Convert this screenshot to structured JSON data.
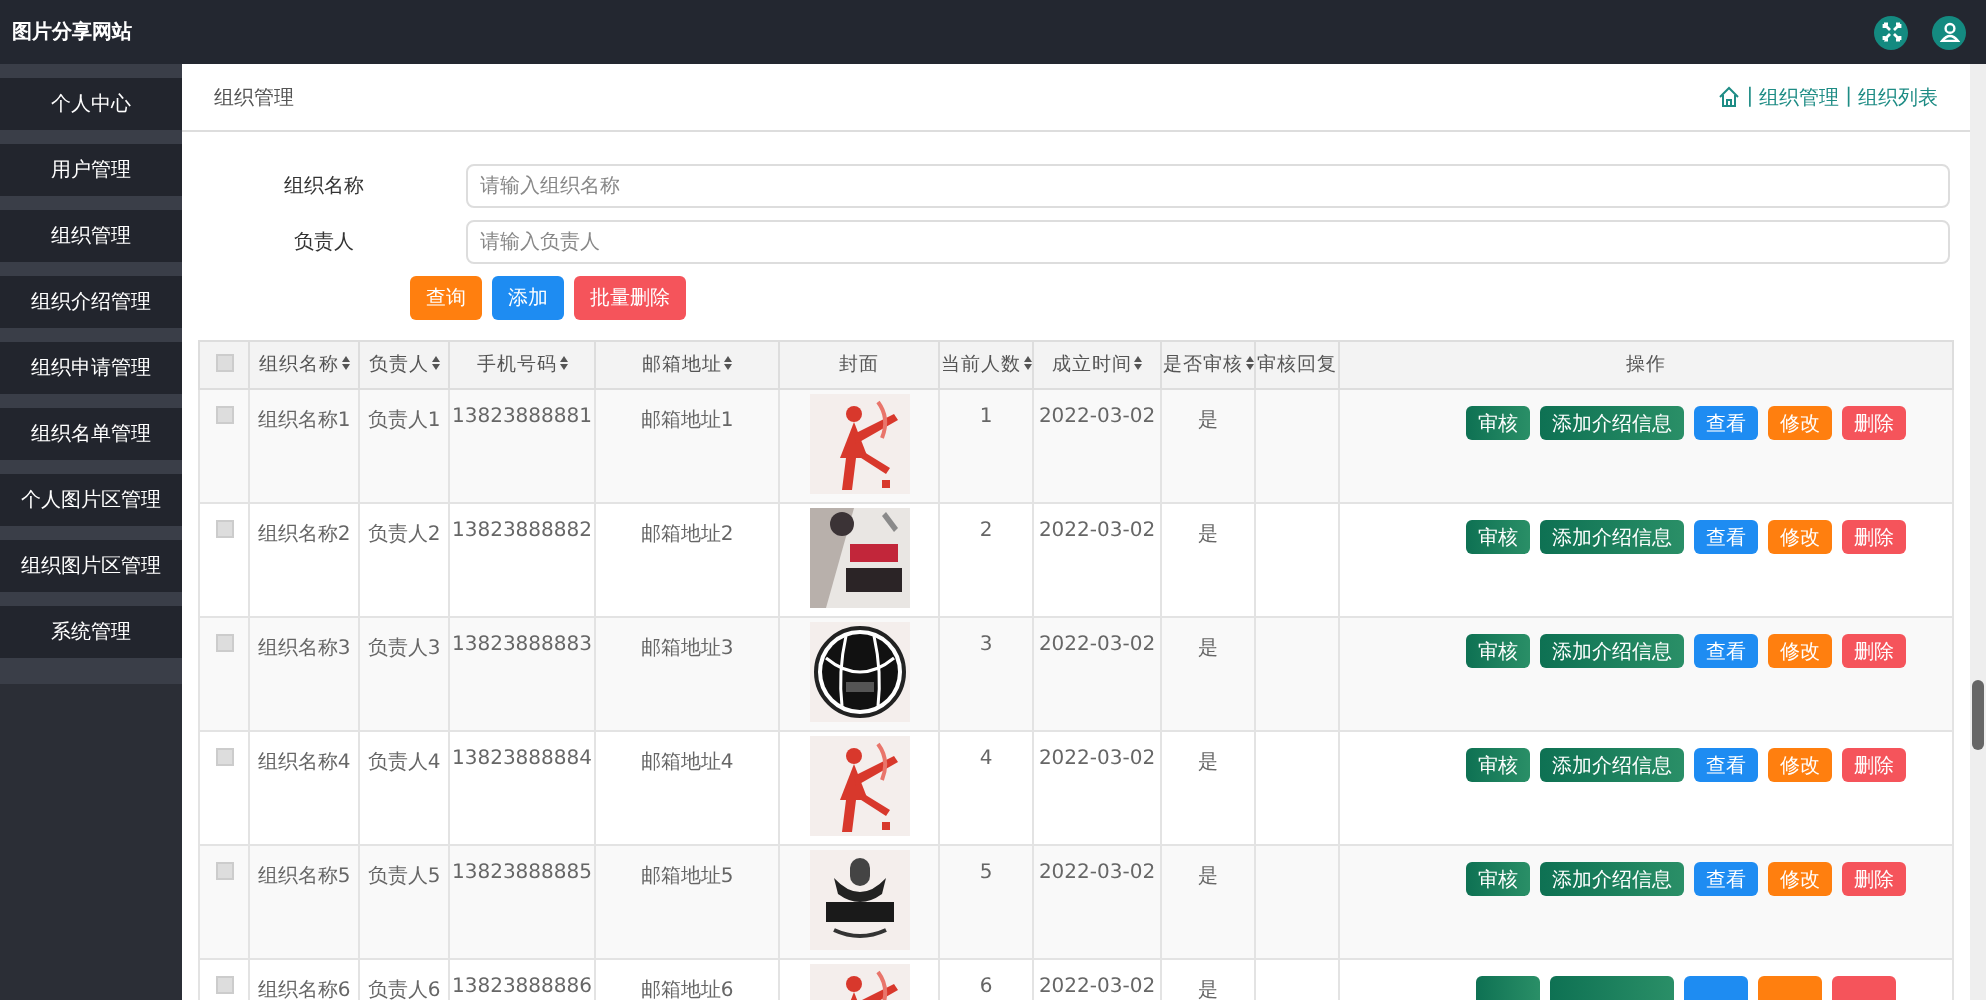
{
  "header": {
    "title": "图片分享网站"
  },
  "sidebar": {
    "items": [
      {
        "label": "个人中心",
        "selected": false
      },
      {
        "label": "用户管理",
        "selected": false
      },
      {
        "label": "组织管理",
        "selected": false
      },
      {
        "label": "组织介绍管理",
        "selected": false
      },
      {
        "label": "组织申请管理",
        "selected": false
      },
      {
        "label": "组织名单管理",
        "selected": false
      },
      {
        "label": "个人图片区管理",
        "selected": false
      },
      {
        "label": "组织图片区管理",
        "selected": false
      },
      {
        "label": "系统管理",
        "selected": false
      }
    ]
  },
  "page_title": "组织管理",
  "breadcrumb": [
    {
      "separator": "|",
      "label": "组织管理"
    },
    {
      "separator": "|",
      "label": "组织列表"
    }
  ],
  "search_form": {
    "fields": [
      {
        "label": "组织名称",
        "placeholder": "请输入组织名称"
      },
      {
        "label": "负责人",
        "placeholder": "请输入负责人"
      }
    ],
    "buttons": [
      {
        "label": "查询",
        "kind": "warning"
      },
      {
        "label": "添加",
        "kind": "primary"
      },
      {
        "label": "批量删除",
        "kind": "danger"
      }
    ]
  },
  "table": {
    "select_all_checked": false,
    "columns": [
      {
        "label": "组织名称",
        "sortable": true
      },
      {
        "label": "负责人",
        "sortable": true
      },
      {
        "label": "手机号码",
        "sortable": true
      },
      {
        "label": "邮箱地址",
        "sortable": true
      },
      {
        "label": "封面",
        "sortable": false
      },
      {
        "label": "当前人数",
        "sortable": true
      },
      {
        "label": "成立时间",
        "sortable": true
      },
      {
        "label": "是否审核",
        "sortable": true
      },
      {
        "label": "审核回复",
        "sortable": false
      },
      {
        "label": "操作",
        "sortable": false
      }
    ],
    "rows": [
      {
        "checked": false,
        "cells": [
          "组织名称1",
          "负责人1",
          "13823888881",
          "邮箱地址1",
          {
            "kind": "picture"
          },
          "1",
          "2022-03-02",
          "是",
          ""
        ],
        "actions": [
          {
            "label": "审核",
            "kind": "review"
          },
          {
            "label": "添加介绍信息",
            "kind": "review"
          },
          {
            "label": "查看",
            "kind": "primary"
          },
          {
            "label": "修改",
            "kind": "warning"
          },
          {
            "label": "删除",
            "kind": "danger"
          }
        ]
      },
      {
        "checked": false,
        "cells": [
          "组织名称2",
          "负责人2",
          "13823888882",
          "邮箱地址2",
          {
            "kind": "picture"
          },
          "2",
          "2022-03-02",
          "是",
          ""
        ],
        "actions": [
          {
            "label": "审核",
            "kind": "review"
          },
          {
            "label": "添加介绍信息",
            "kind": "review"
          },
          {
            "label": "查看",
            "kind": "primary"
          },
          {
            "label": "修改",
            "kind": "warning"
          },
          {
            "label": "删除",
            "kind": "danger"
          }
        ]
      },
      {
        "checked": false,
        "cells": [
          "组织名称3",
          "负责人3",
          "13823888883",
          "邮箱地址3",
          {
            "kind": "picture"
          },
          "3",
          "2022-03-02",
          "是",
          ""
        ],
        "actions": [
          {
            "label": "审核",
            "kind": "review"
          },
          {
            "label": "添加介绍信息",
            "kind": "review"
          },
          {
            "label": "查看",
            "kind": "primary"
          },
          {
            "label": "修改",
            "kind": "warning"
          },
          {
            "label": "删除",
            "kind": "danger"
          }
        ]
      },
      {
        "checked": false,
        "cells": [
          "组织名称4",
          "负责人4",
          "13823888884",
          "邮箱地址4",
          {
            "kind": "picture"
          },
          "4",
          "2022-03-02",
          "是",
          ""
        ],
        "actions": [
          {
            "label": "审核",
            "kind": "review"
          },
          {
            "label": "添加介绍信息",
            "kind": "review"
          },
          {
            "label": "查看",
            "kind": "primary"
          },
          {
            "label": "修改",
            "kind": "warning"
          },
          {
            "label": "删除",
            "kind": "danger"
          }
        ]
      },
      {
        "checked": false,
        "cells": [
          "组织名称5",
          "负责人5",
          "13823888885",
          "邮箱地址5",
          {
            "kind": "picture"
          },
          "5",
          "2022-03-02",
          "是",
          ""
        ],
        "actions": [
          {
            "label": "审核",
            "kind": "review"
          },
          {
            "label": "添加介绍信息",
            "kind": "review"
          },
          {
            "label": "查看",
            "kind": "primary"
          },
          {
            "label": "修改",
            "kind": "warning"
          },
          {
            "label": "删除",
            "kind": "danger"
          }
        ]
      },
      {
        "checked": false,
        "cells": [
          "组织名称6",
          "负责人6",
          "13823888886",
          "邮箱地址6",
          {
            "kind": "picture"
          },
          "6",
          "2022-03-02",
          "是",
          ""
        ],
        "actions": [
          {
            "kind": "review"
          },
          {
            "kind": "review"
          },
          {
            "kind": "primary"
          },
          {
            "kind": "warning"
          },
          {
            "kind": "danger"
          }
        ]
      }
    ]
  }
}
